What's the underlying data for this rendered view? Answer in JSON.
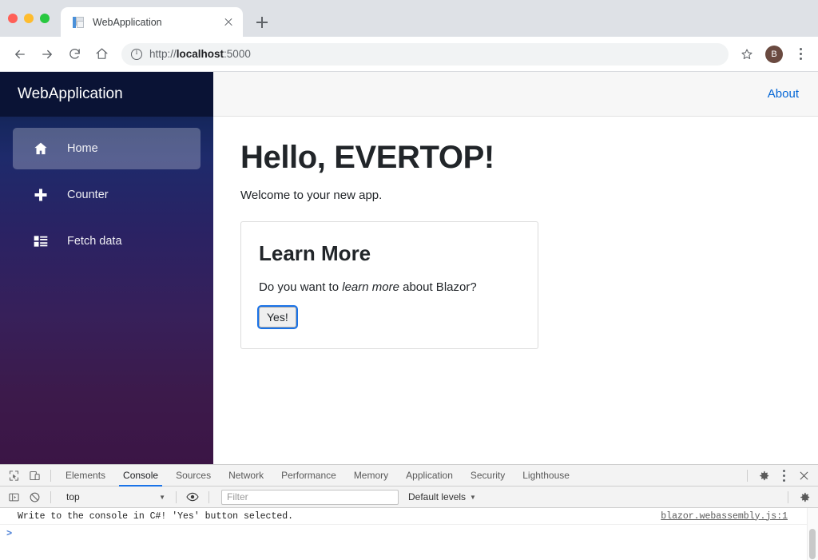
{
  "browser": {
    "tab": {
      "title": "WebApplication",
      "favicon_icon": "page-icon",
      "close_icon": "close-icon"
    },
    "new_tab_icon": "plus-icon",
    "nav": {
      "back_icon": "arrow-left-icon",
      "forward_icon": "arrow-right-icon",
      "reload_icon": "reload-icon",
      "home_icon": "home-icon"
    },
    "omnibox": {
      "info_icon": "info-circle-icon",
      "url_scheme": "http://",
      "url_host": "localhost",
      "url_port": ":5000",
      "full_url": "http://localhost:5000"
    },
    "star_icon": "star-icon",
    "avatar_letter": "B",
    "menu_icon": "kebab-menu-icon",
    "traffic_lights": [
      "close",
      "minimize",
      "zoom"
    ]
  },
  "app": {
    "brand_title": "WebApplication",
    "sidebar": {
      "items": [
        {
          "label": "Home",
          "icon": "home-icon",
          "active": true
        },
        {
          "label": "Counter",
          "icon": "plus-icon",
          "active": false
        },
        {
          "label": "Fetch data",
          "icon": "list-icon",
          "active": false
        }
      ]
    },
    "topbar": {
      "about_label": "About",
      "about_color": "#0366d6"
    },
    "main": {
      "heading": "Hello, EVERTOP!",
      "welcome": "Welcome to your new app.",
      "card": {
        "title": "Learn More",
        "text_before": "Do you want to ",
        "text_emphasis": "learn more",
        "text_after": " about Blazor?",
        "button_label": "Yes!"
      }
    },
    "sidebar_gradient_from": "#0b1538",
    "sidebar_gradient_to": "#3b1545"
  },
  "devtools": {
    "inspect_icon": "inspect-element-icon",
    "device_icon": "device-toolbar-icon",
    "tabs": [
      {
        "label": "Elements",
        "active": false
      },
      {
        "label": "Console",
        "active": true
      },
      {
        "label": "Sources",
        "active": false
      },
      {
        "label": "Network",
        "active": false
      },
      {
        "label": "Performance",
        "active": false
      },
      {
        "label": "Memory",
        "active": false
      },
      {
        "label": "Application",
        "active": false
      },
      {
        "label": "Security",
        "active": false
      },
      {
        "label": "Lighthouse",
        "active": false
      }
    ],
    "settings_icon": "gear-icon",
    "more_icon": "kebab-menu-icon",
    "close_icon": "close-icon",
    "filterbar": {
      "sidebar_toggle_icon": "console-sidebar-icon",
      "clear_icon": "clear-console-icon",
      "context": "top",
      "eye_icon": "eye-icon",
      "filter_placeholder": "Filter",
      "filter_value": "",
      "levels_label": "Default levels",
      "levels_caret": "▼",
      "settings_icon": "gear-icon"
    },
    "console": {
      "messages": [
        {
          "text": "Write to the console in C#! 'Yes' button selected.",
          "source": "blazor.webassembly.js:1"
        }
      ],
      "prompt": ">"
    },
    "active_tab_underline_color": "#1a73e8"
  }
}
